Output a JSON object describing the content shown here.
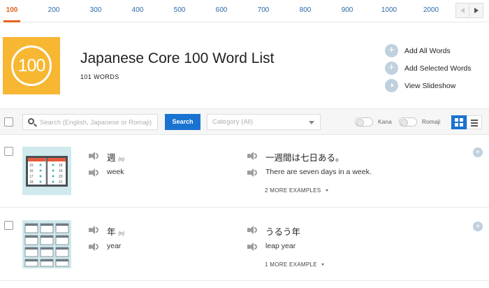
{
  "tabs": [
    {
      "label": "100",
      "active": true
    },
    {
      "label": "200",
      "active": false
    },
    {
      "label": "300",
      "active": false
    },
    {
      "label": "400",
      "active": false
    },
    {
      "label": "500",
      "active": false
    },
    {
      "label": "600",
      "active": false
    },
    {
      "label": "700",
      "active": false
    },
    {
      "label": "800",
      "active": false
    },
    {
      "label": "900",
      "active": false
    },
    {
      "label": "1000",
      "active": false
    },
    {
      "label": "2000",
      "active": false
    }
  ],
  "header": {
    "logo_text": "100",
    "title": "Japanese Core 100 Word List",
    "word_count": "101 WORDS"
  },
  "actions": [
    {
      "label": "Add All Words",
      "icon": "plus-icon"
    },
    {
      "label": "Add Selected Words",
      "icon": "plus-icon"
    },
    {
      "label": "View Slideshow",
      "icon": "play-icon"
    }
  ],
  "toolbar": {
    "search_placeholder": "Search (English, Japanese or Romaji)",
    "search_label": "Search",
    "category_placeholder": "Category (All)",
    "kana_label": "Kana",
    "romaji_label": "Romaji"
  },
  "words": [
    {
      "word": "週",
      "pos": "(n)",
      "meaning": "week",
      "example_jp": "一週間は七日ある。",
      "example_en": "There are seven days in a week.",
      "more_examples": "2 MORE EXAMPLES"
    },
    {
      "word": "年",
      "pos": "(n)",
      "meaning": "year",
      "example_jp": "うるう年",
      "example_en": "leap year",
      "more_examples": "1 MORE EXAMPLE"
    }
  ],
  "colors": {
    "accent_active_tab": "#e0641f",
    "link_blue": "#2b6aa8",
    "primary_button": "#1a73d1",
    "logo_bg": "#f7b733",
    "action_circle": "#bfd0df"
  }
}
